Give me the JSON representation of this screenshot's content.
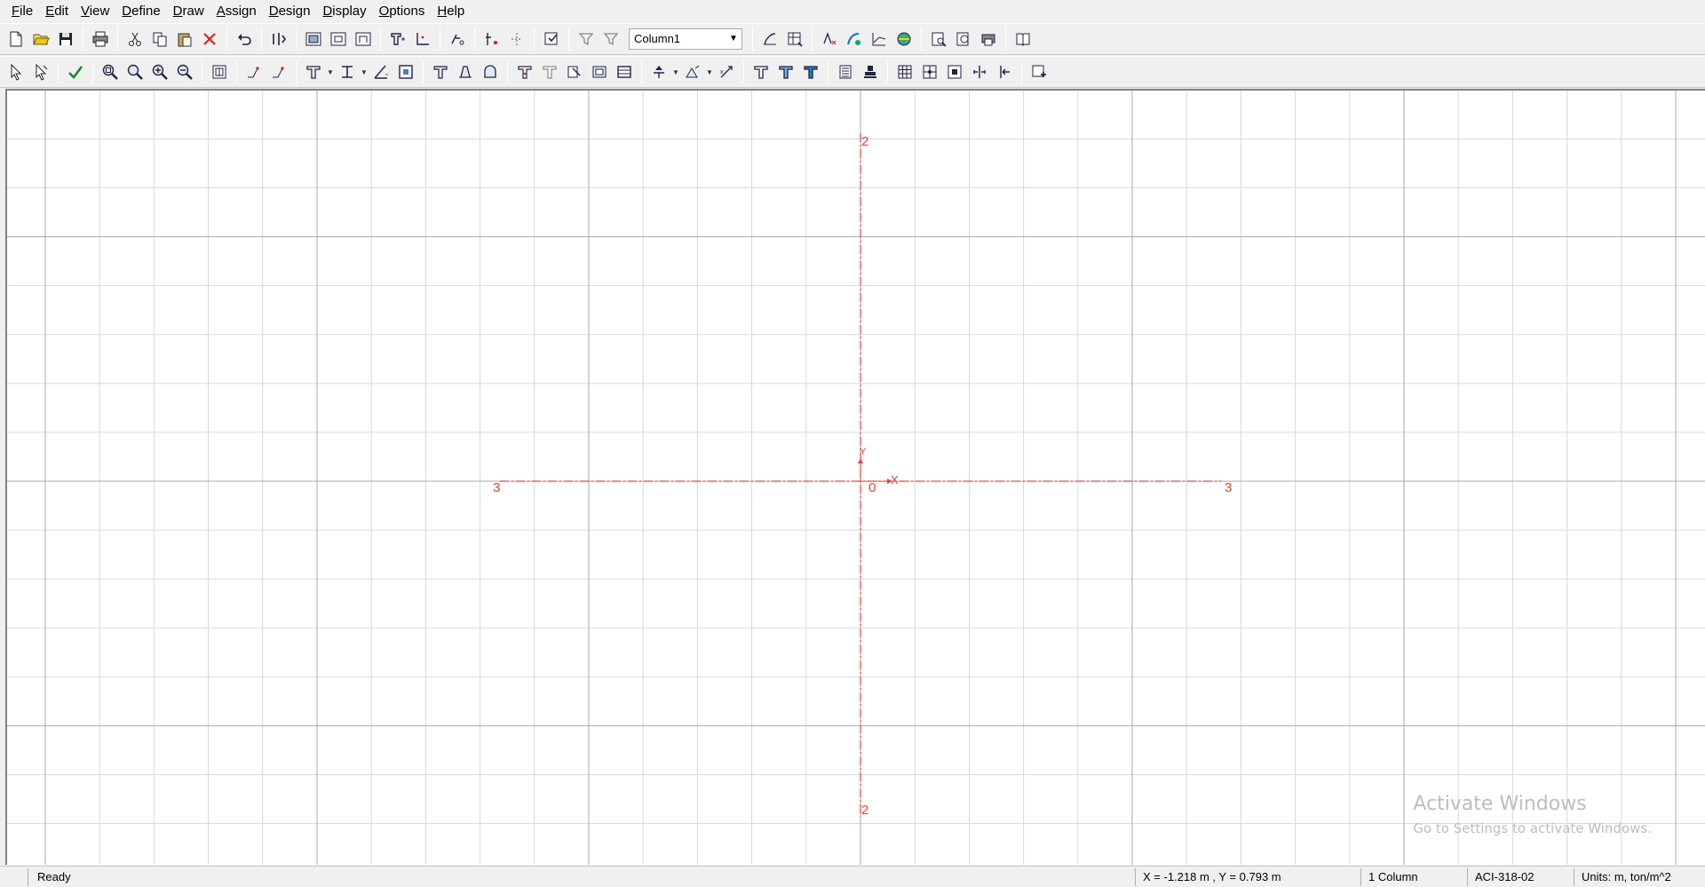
{
  "menu": [
    {
      "mnemonic": "F",
      "rest": "ile"
    },
    {
      "mnemonic": "E",
      "rest": "dit"
    },
    {
      "mnemonic": "V",
      "rest": "iew"
    },
    {
      "mnemonic": "D",
      "rest": "efine"
    },
    {
      "mnemonic": "D",
      "rest": "raw"
    },
    {
      "mnemonic": "A",
      "rest": "ssign"
    },
    {
      "mnemonic": "D",
      "rest": "esign"
    },
    {
      "mnemonic": "D",
      "rest": "isplay"
    },
    {
      "mnemonic": "O",
      "rest": "ptions"
    },
    {
      "mnemonic": "H",
      "rest": "elp"
    }
  ],
  "toolbar": {
    "section_value": "Column1"
  },
  "canvas": {
    "axis_color": "#e8443a",
    "grid_color": "#d9d9d9",
    "major_grid_color": "#a9a9a9",
    "labels": {
      "top": "2",
      "bottom": "2",
      "left": "3",
      "right": "3",
      "origin": "0",
      "x_axis": "X",
      "y_axis": "Y"
    }
  },
  "watermark": {
    "title": "Activate Windows",
    "subtitle": "Go to Settings to activate Windows."
  },
  "statusbar": {
    "ready": "Ready",
    "coords": "X = -1.218 m , Y = 0.793 m",
    "count": "1 Column",
    "code": "ACI-318-02",
    "units": "Units: m, ton/m^2"
  }
}
